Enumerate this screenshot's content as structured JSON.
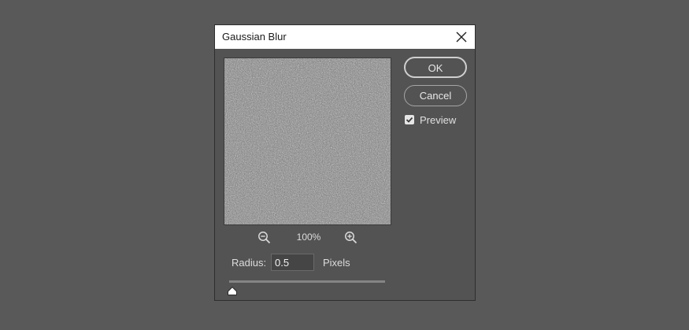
{
  "dialog": {
    "title": "Gaussian Blur",
    "close_icon": "close-icon"
  },
  "buttons": {
    "ok_label": "OK",
    "cancel_label": "Cancel"
  },
  "preview": {
    "label": "Preview",
    "checked": true
  },
  "zoom": {
    "level": "100%",
    "zoom_out_icon": "zoom-out-icon",
    "zoom_in_icon": "zoom-in-icon"
  },
  "radius": {
    "label": "Radius:",
    "value": "0.5",
    "unit": "Pixels",
    "slider_fraction": 0.0
  },
  "colors": {
    "background": "#595959",
    "dialog_bg": "#535353",
    "titlebar_bg": "#ffffff",
    "preview_noise": "#808080"
  }
}
